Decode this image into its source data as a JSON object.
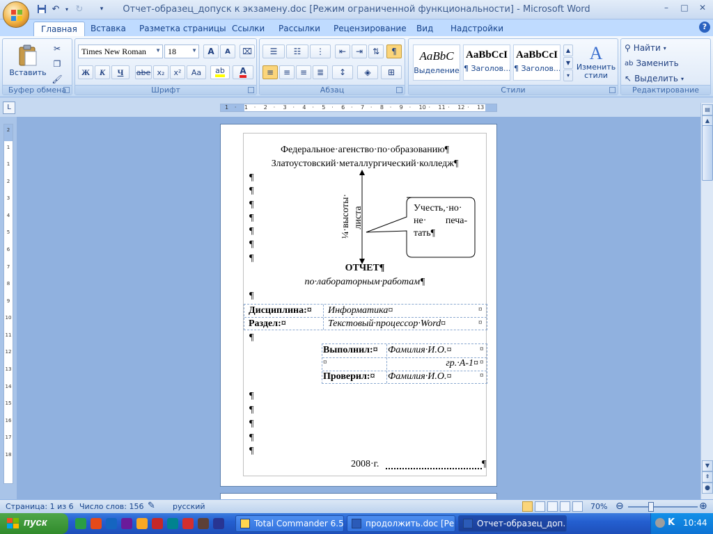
{
  "titlebar": {
    "title": "Отчет-образец_допуск к экзамену.doc [Режим ограниченной функциональности] - Microsoft Word",
    "minimize": "–",
    "maximize": "□",
    "close": "✕"
  },
  "tabs": [
    "Главная",
    "Вставка",
    "Разметка страницы",
    "Ссылки",
    "Рассылки",
    "Рецензирование",
    "Вид",
    "Надстройки"
  ],
  "help_label": "?",
  "ribbon": {
    "clipboard": {
      "paste_label": "Вставить",
      "group_label": "Буфер обмена"
    },
    "font": {
      "font_name": "Times New Roman",
      "font_size": "18",
      "group_label": "Шрифт",
      "bold": "Ж",
      "italic": "К",
      "underline": "Ч",
      "strike": "abe",
      "subscript": "x₂",
      "superscript": "x²",
      "change_case": "Aa",
      "grow": "A",
      "shrink": "A"
    },
    "paragraph": {
      "group_label": "Абзац",
      "pilcrow": "¶"
    },
    "styles": {
      "group_label": "Стили",
      "items": [
        {
          "sample": "AaBbC",
          "name": "Выделение"
        },
        {
          "sample": "AaBbCcI",
          "name": "¶ Заголов..."
        },
        {
          "sample": "AaBbCcI",
          "name": "¶ Заголов..."
        }
      ],
      "change_styles": "Изменить стили"
    },
    "editing": {
      "group_label": "Редактирование",
      "find": "Найти",
      "replace": "Заменить",
      "select": "Выделить"
    }
  },
  "ruler": {
    "h_ticks": [
      "1",
      "·",
      "1",
      "·",
      "2",
      "·",
      "3",
      "·",
      "4",
      "·",
      "5",
      "·",
      "6",
      "·",
      "7",
      "·",
      "8",
      "·",
      "9",
      "·",
      "10",
      "·",
      "11",
      "·",
      "12",
      "·",
      "13"
    ],
    "v_ticks": [
      "2",
      "1",
      "1",
      "2",
      "3",
      "4",
      "5",
      "6",
      "7",
      "8",
      "9",
      "10",
      "11",
      "12",
      "13",
      "14",
      "15",
      "16",
      "17",
      "18"
    ]
  },
  "document": {
    "line1": "Федеральное·агенство·по·образованию¶",
    "line2": "Златоустовский·металлургический·колледж¶",
    "arrow_label_a": "¼·высоты·",
    "arrow_label_b": "листа",
    "callout_line1": "Учесть,·но·",
    "callout_line2": "не· печа-",
    "callout_line3": "тать¶",
    "report_title": "ОТЧЕТ¶",
    "report_subtitle": "по·лабораторным·работам¶",
    "table1": [
      {
        "label": "Дисциплина:¤",
        "value": "Информатика¤",
        "end": "¤"
      },
      {
        "label": "Раздел:¤",
        "value": "Текстовый·процессор·Word¤",
        "end": "¤"
      }
    ],
    "table2": [
      {
        "label": "Выполнил:¤",
        "value": "Фамилия·И.О.¤",
        "end": "¤"
      },
      {
        "label": "¤",
        "value": "гр.·А-1¤",
        "end": "¤"
      },
      {
        "label": "Проверил:¤",
        "value": "Фамилия·И.О.¤",
        "end": "¤"
      }
    ],
    "year_line": "2008·г.",
    "pilcrow": "¶"
  },
  "statusbar": {
    "page": "Страница: 1 из 6",
    "words": "Число слов: 156",
    "language": "русский",
    "zoom": "70%",
    "zoom_level": 0.7
  },
  "taskbar": {
    "start": "пуск",
    "windows": [
      {
        "label": "Total Commander 6.5...",
        "active": false
      },
      {
        "label": "продолжить.doc [Ре...",
        "active": false
      },
      {
        "label": "Отчет-образец_доп...",
        "active": true
      }
    ],
    "clock": "10:44"
  }
}
